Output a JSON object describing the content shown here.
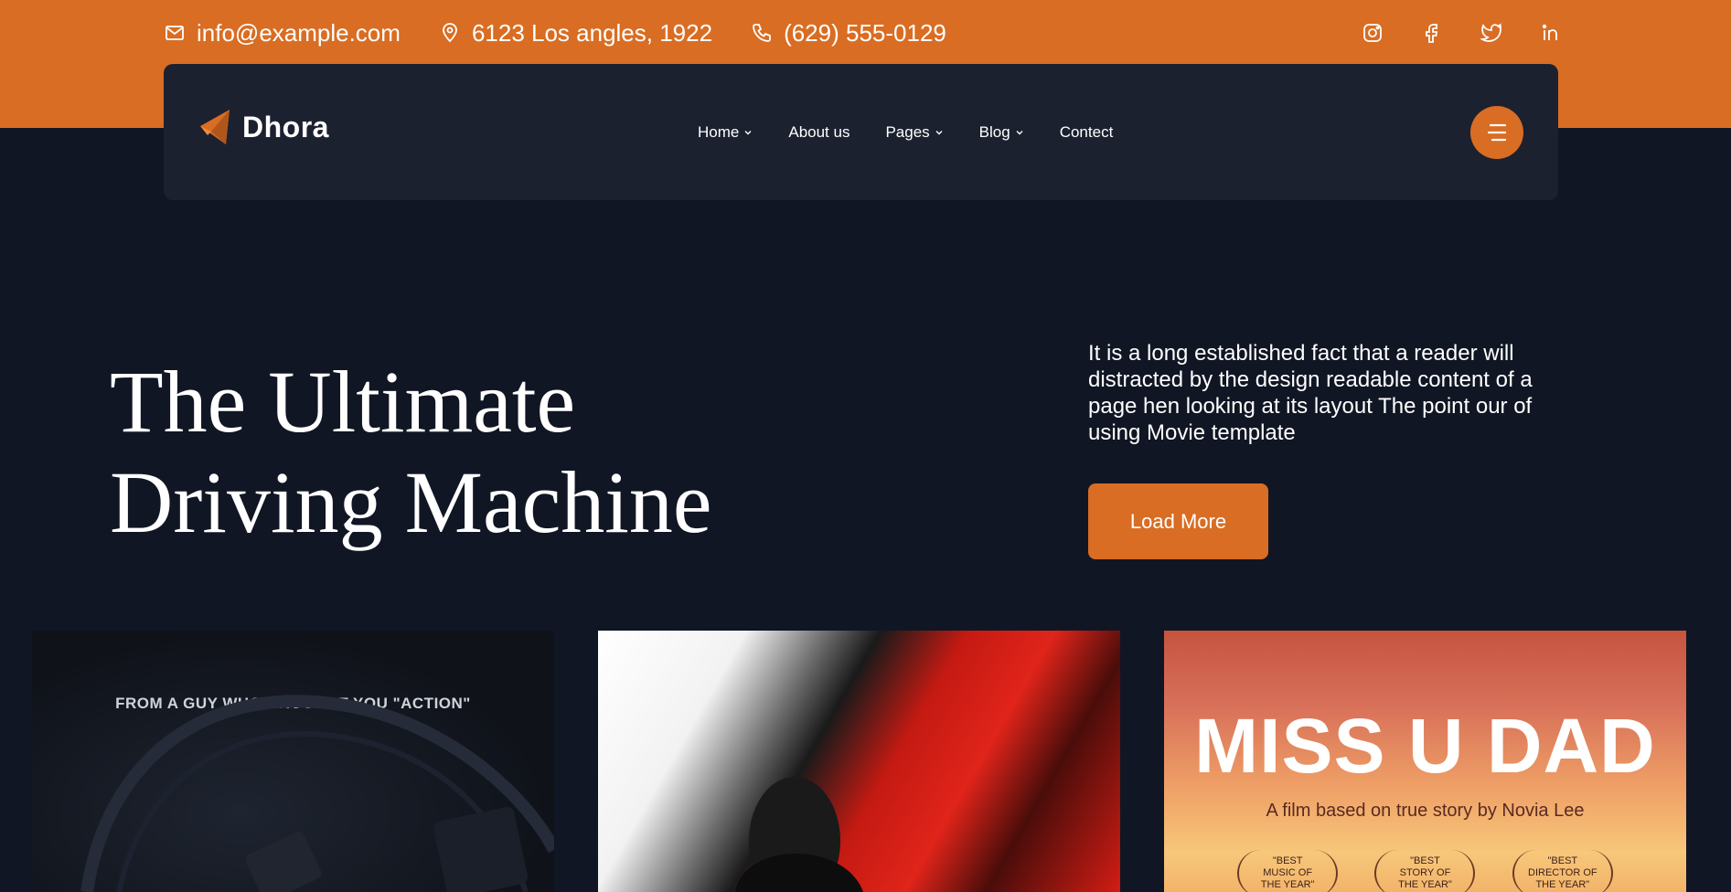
{
  "topbar": {
    "email": "info@example.com",
    "address": "6123 Los angles, 1922",
    "phone": "(629) 555-0129",
    "socials": [
      "instagram-icon",
      "facebook-icon",
      "twitter-icon",
      "linkedin-icon"
    ]
  },
  "nav": {
    "logo_text": "Dhora",
    "items": [
      {
        "label": "Home",
        "dropdown": true
      },
      {
        "label": "About us",
        "dropdown": false
      },
      {
        "label": "Pages",
        "dropdown": true
      },
      {
        "label": "Blog",
        "dropdown": true
      },
      {
        "label": "Contect",
        "dropdown": false
      }
    ]
  },
  "hero": {
    "title_line1": "The Ultimate",
    "title_line2": "Driving Machine",
    "description": "It is a long established fact that a reader will distracted by the design readable content of a page hen looking at its layout The point our of using Movie template",
    "button_label": "Load More"
  },
  "cards": {
    "card1_tagline": "FROM A GUY WHO BROUGHT YOU \"ACTION\"",
    "card3_title": "MISS U DAD",
    "card3_subtitle": "A film based on true story by Novia Lee",
    "card3_awards": [
      [
        "\"BEST",
        "MUSIC OF",
        "THE YEAR\""
      ],
      [
        "\"BEST",
        "STORY OF",
        "THE YEAR\""
      ],
      [
        "\"BEST",
        "DIRECTOR OF",
        "THE YEAR\""
      ]
    ]
  },
  "colors": {
    "accent": "#d96d23",
    "background": "#111624",
    "navbar": "#1c2130"
  }
}
